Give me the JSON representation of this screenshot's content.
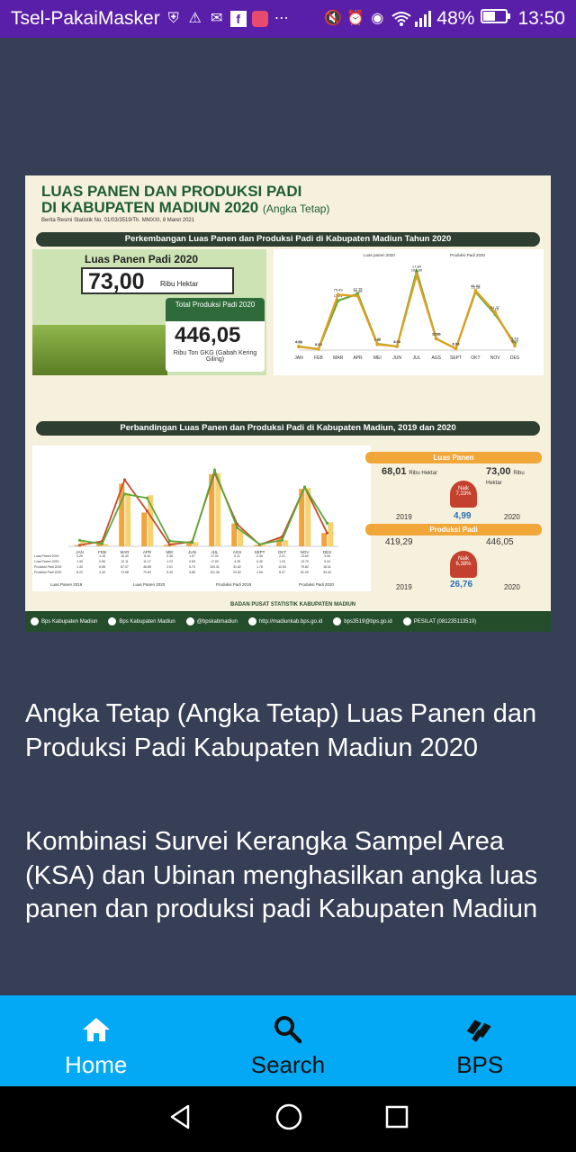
{
  "status_bar": {
    "carrier": "Tsel-PakaiMasker",
    "battery": "48%",
    "time": "13:50"
  },
  "infographic": {
    "title_line1": "LUAS PANEN DAN PRODUKSI PADI",
    "title_line2": "DI KABUPATEN MADIUN 2020",
    "title_suffix": "(Angka Tetap)",
    "subtitle": "Berita Resmi Statistik No. 01/03/3519/Th. MMXXI, 8 Maret 2021",
    "band1": "Perkembangan Luas Panen dan Produksi Padi di Kabupaten Madiun Tahun 2020",
    "band2": "Perbandingan Luas Panen dan Produksi Padi di Kabupaten Madiun, 2019 dan 2020",
    "luas_label": "Luas Panen Padi 2020",
    "luas_value": "73,00",
    "luas_unit": "Ribu Hektar",
    "prod_label": "Total Produksi Padi 2020",
    "prod_value": "446,05",
    "prod_unit": "Ribu Ton GKG (Gabah Kering Giling)",
    "cmp": {
      "luas_head": "Luas Panen",
      "luas_2019": "68,01",
      "luas_2020": "73,00",
      "luas_unit": "Ribu Hektar",
      "luas_naik": "Naik 7,33%",
      "luas_diff": "4,99",
      "prod_head": "Produksi Padi",
      "prod_2019": "419,29",
      "prod_2020": "446,05",
      "prod_unit": "Ribu Ton",
      "prod_naik": "Naik 6,38%",
      "prod_diff": "26,76",
      "year_2019": "2019",
      "year_2020": "2020"
    },
    "footer": {
      "facebook": "Bps Kabupaten Madiun",
      "youtube": "Bps Kabupaten Madiun",
      "instagram": "@bpskabmadiun",
      "web": "http://madiunkab.bps.go.id",
      "email": "bps3519@bps.go.id",
      "whatsapp": "PESILAT (08123511351​9)",
      "org": "BADAN PUSAT STATISTIK KABUPATEN MADIUN"
    }
  },
  "chart_data": [
    {
      "type": "line",
      "categories": [
        "JAN",
        "FEB",
        "MAR",
        "APR",
        "MEI",
        "JUN",
        "JUL",
        "AGS",
        "SEPT",
        "OKT",
        "NOV",
        "DES"
      ],
      "series": [
        {
          "name": "Luas panen 2020",
          "values": [
            0.82,
            0.23,
            11.21,
            12.75,
            1.42,
            0.83,
            17.84,
            2.58,
            0.33,
            13.18,
            8.12,
            1.48
          ]
        },
        {
          "name": "Produksi Padi 2020",
          "values": [
            4.56,
            1.45,
            75.49,
            73.45,
            7.62,
            4.91,
            101.99,
            15.26,
            1.96,
            81.0,
            51.37,
            5.8
          ]
        }
      ]
    },
    {
      "type": "bar",
      "categories": [
        "JAN",
        "FEB",
        "MAR",
        "APR",
        "MEI",
        "JUN",
        "JUL",
        "AGS",
        "SEPT",
        "OKT",
        "NOV",
        "DES"
      ],
      "series": [
        {
          "name": "Luas Panen 2019",
          "values": [
            0.25,
            1.18,
            15.4,
            8.16,
            0.36,
            1.07,
            17.01,
            5.11,
            0.36,
            2.21,
            13.69,
            3.06
          ]
        },
        {
          "name": "Luas Panen 2020",
          "values": [
            1.39,
            0.56,
            12.11,
            11.17,
            1.22,
            0.83,
            17.63,
            4.28,
            0.46,
            1.43,
            13.7,
            5.34
          ]
        },
        {
          "name": "Produksi Padi 2019",
          "values": [
            1.4,
            6.58,
            87.07,
            46.85,
            2.01,
            5.73,
            100.31,
            31.62,
            1.78,
            12.53,
            79.82,
            18.51
          ]
        },
        {
          "name": "Produksi Padi 2020",
          "values": [
            8.22,
            3.4,
            73.68,
            70.83,
            5.3,
            5.88,
            101.36,
            23.52,
            2.56,
            8.37,
            81.0,
            33.4
          ]
        }
      ]
    }
  ],
  "article": {
    "title": "Angka Tetap (Angka Tetap) Luas Panen dan Produksi Padi Kabupaten Madiun 2020",
    "description": "Kombinasi Survei Kerangka Sampel Area (KSA) dan Ubinan menghasilkan angka luas panen dan produksi padi Kabupaten Madiun"
  },
  "bottom_nav": {
    "items": [
      {
        "label": "Home",
        "icon": "home-icon",
        "active": true
      },
      {
        "label": "Search",
        "icon": "search-icon",
        "active": false
      },
      {
        "label": "BPS",
        "icon": "bps-logo-icon",
        "active": false
      }
    ],
    "active_color": "#ffffff",
    "inactive_color": "#111111",
    "background": "#03a9f4"
  },
  "colors": {
    "status_bar": "#5a1fa8",
    "page_background": "#373f57"
  }
}
